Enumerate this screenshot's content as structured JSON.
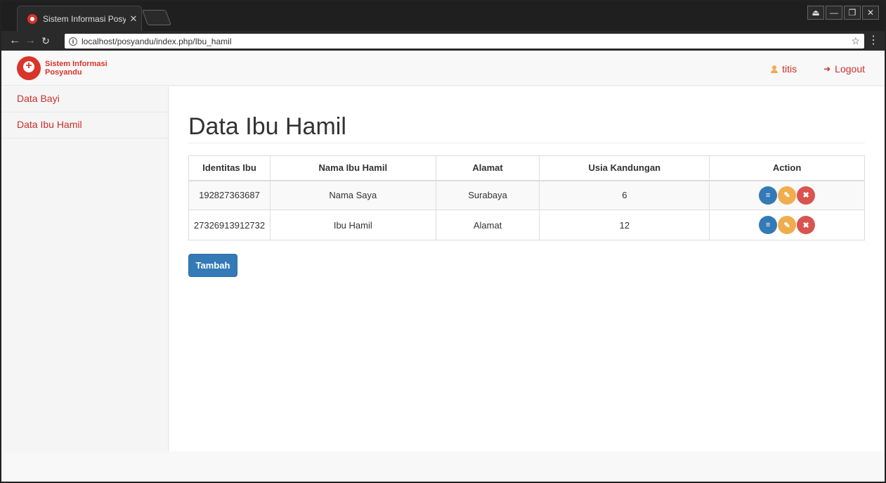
{
  "browser": {
    "tab_title": "Sistem Informasi Posyan",
    "tab_close": "✕",
    "url": "localhost/posyandu/index.php/Ibu_hamil",
    "window_controls": [
      "⏏",
      "—",
      "❐",
      "✕"
    ]
  },
  "navbar": {
    "brand_line1": "Sistem Informasi",
    "brand_line2": "Posyandu",
    "user_label": "titis",
    "logout_label": "Logout"
  },
  "sidebar": {
    "items": [
      {
        "label": "Data Bayi"
      },
      {
        "label": "Data Ibu Hamil"
      }
    ]
  },
  "main": {
    "title": "Data Ibu Hamil",
    "table": {
      "headers": [
        "Identitas Ibu",
        "Nama Ibu Hamil",
        "Alamat",
        "Usia Kandungan",
        "Action"
      ],
      "rows": [
        [
          "192827363687",
          "Nama Saya",
          "Surabaya",
          "6"
        ],
        [
          "27326913912732",
          "Ibu Hamil",
          "Alamat",
          "12"
        ]
      ]
    },
    "add_button": "Tambah"
  },
  "colors": {
    "accent": "#d9342a",
    "primary": "#337ab7",
    "warning": "#f0ad4e",
    "danger": "#d9534f"
  }
}
